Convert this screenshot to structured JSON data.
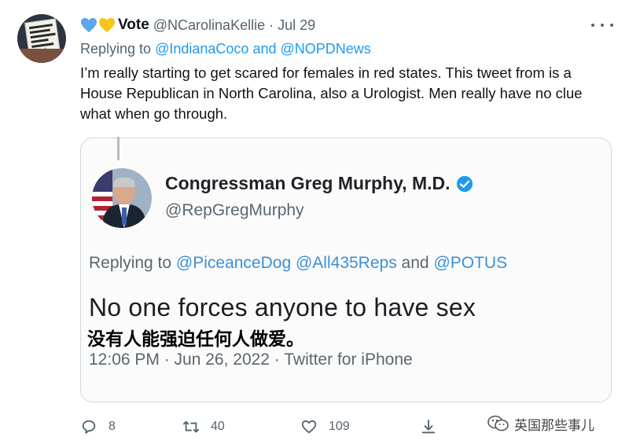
{
  "tweet": {
    "display_name": "Vote",
    "handle": "@NCarolinaKellie",
    "separator": "·",
    "time": "Jul 29",
    "replying_prefix": "Replying to",
    "replying_user1": "@IndianaCoco",
    "replying_and": "and",
    "replying_user2": "@NOPDNews",
    "text": "I’m really starting to get scared for females in red states. This tweet from is a House Republican in North Carolina, also a Urologist. Men really have no clue what when go through.",
    "heart_colors": [
      "#5da7e6",
      "#f5c518"
    ],
    "avatar_sign_text": "IF I WANTED THE GOVT IN MY UTERUS I'D REPRO MATT GAETZ"
  },
  "embedded": {
    "name": "Congressman Greg Murphy, M.D.",
    "handle": "@RepGregMurphy",
    "replying_prefix": "Replying to",
    "replying_user1": "@PiceanceDog",
    "replying_user2": "@All435Reps",
    "replying_and": "and",
    "replying_user3": "@POTUS",
    "text": "No one forces anyone to have sex",
    "caption_cn": "没有人能强迫任何人做爱。",
    "meta": "12:06 PM · Jun 26, 2022 · Twitter for iPhone",
    "verified_color": "#1d9bf0"
  },
  "actions": {
    "reply_count": "8",
    "retweet_count": "40",
    "like_count": "109",
    "icons": [
      "reply-icon",
      "retweet-icon",
      "like-icon",
      "share-icon"
    ]
  },
  "watermark": {
    "text": "英国那些事儿"
  }
}
